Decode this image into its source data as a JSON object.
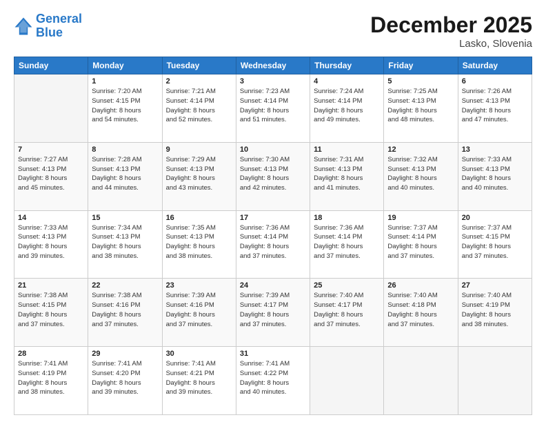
{
  "header": {
    "logo_line1": "General",
    "logo_line2": "Blue",
    "month_year": "December 2025",
    "location": "Lasko, Slovenia"
  },
  "weekdays": [
    "Sunday",
    "Monday",
    "Tuesday",
    "Wednesday",
    "Thursday",
    "Friday",
    "Saturday"
  ],
  "weeks": [
    [
      {
        "day": "",
        "info": ""
      },
      {
        "day": "1",
        "info": "Sunrise: 7:20 AM\nSunset: 4:15 PM\nDaylight: 8 hours\nand 54 minutes."
      },
      {
        "day": "2",
        "info": "Sunrise: 7:21 AM\nSunset: 4:14 PM\nDaylight: 8 hours\nand 52 minutes."
      },
      {
        "day": "3",
        "info": "Sunrise: 7:23 AM\nSunset: 4:14 PM\nDaylight: 8 hours\nand 51 minutes."
      },
      {
        "day": "4",
        "info": "Sunrise: 7:24 AM\nSunset: 4:14 PM\nDaylight: 8 hours\nand 49 minutes."
      },
      {
        "day": "5",
        "info": "Sunrise: 7:25 AM\nSunset: 4:13 PM\nDaylight: 8 hours\nand 48 minutes."
      },
      {
        "day": "6",
        "info": "Sunrise: 7:26 AM\nSunset: 4:13 PM\nDaylight: 8 hours\nand 47 minutes."
      }
    ],
    [
      {
        "day": "7",
        "info": "Sunrise: 7:27 AM\nSunset: 4:13 PM\nDaylight: 8 hours\nand 45 minutes."
      },
      {
        "day": "8",
        "info": "Sunrise: 7:28 AM\nSunset: 4:13 PM\nDaylight: 8 hours\nand 44 minutes."
      },
      {
        "day": "9",
        "info": "Sunrise: 7:29 AM\nSunset: 4:13 PM\nDaylight: 8 hours\nand 43 minutes."
      },
      {
        "day": "10",
        "info": "Sunrise: 7:30 AM\nSunset: 4:13 PM\nDaylight: 8 hours\nand 42 minutes."
      },
      {
        "day": "11",
        "info": "Sunrise: 7:31 AM\nSunset: 4:13 PM\nDaylight: 8 hours\nand 41 minutes."
      },
      {
        "day": "12",
        "info": "Sunrise: 7:32 AM\nSunset: 4:13 PM\nDaylight: 8 hours\nand 40 minutes."
      },
      {
        "day": "13",
        "info": "Sunrise: 7:33 AM\nSunset: 4:13 PM\nDaylight: 8 hours\nand 40 minutes."
      }
    ],
    [
      {
        "day": "14",
        "info": "Sunrise: 7:33 AM\nSunset: 4:13 PM\nDaylight: 8 hours\nand 39 minutes."
      },
      {
        "day": "15",
        "info": "Sunrise: 7:34 AM\nSunset: 4:13 PM\nDaylight: 8 hours\nand 38 minutes."
      },
      {
        "day": "16",
        "info": "Sunrise: 7:35 AM\nSunset: 4:13 PM\nDaylight: 8 hours\nand 38 minutes."
      },
      {
        "day": "17",
        "info": "Sunrise: 7:36 AM\nSunset: 4:14 PM\nDaylight: 8 hours\nand 37 minutes."
      },
      {
        "day": "18",
        "info": "Sunrise: 7:36 AM\nSunset: 4:14 PM\nDaylight: 8 hours\nand 37 minutes."
      },
      {
        "day": "19",
        "info": "Sunrise: 7:37 AM\nSunset: 4:14 PM\nDaylight: 8 hours\nand 37 minutes."
      },
      {
        "day": "20",
        "info": "Sunrise: 7:37 AM\nSunset: 4:15 PM\nDaylight: 8 hours\nand 37 minutes."
      }
    ],
    [
      {
        "day": "21",
        "info": "Sunrise: 7:38 AM\nSunset: 4:15 PM\nDaylight: 8 hours\nand 37 minutes."
      },
      {
        "day": "22",
        "info": "Sunrise: 7:38 AM\nSunset: 4:16 PM\nDaylight: 8 hours\nand 37 minutes."
      },
      {
        "day": "23",
        "info": "Sunrise: 7:39 AM\nSunset: 4:16 PM\nDaylight: 8 hours\nand 37 minutes."
      },
      {
        "day": "24",
        "info": "Sunrise: 7:39 AM\nSunset: 4:17 PM\nDaylight: 8 hours\nand 37 minutes."
      },
      {
        "day": "25",
        "info": "Sunrise: 7:40 AM\nSunset: 4:17 PM\nDaylight: 8 hours\nand 37 minutes."
      },
      {
        "day": "26",
        "info": "Sunrise: 7:40 AM\nSunset: 4:18 PM\nDaylight: 8 hours\nand 37 minutes."
      },
      {
        "day": "27",
        "info": "Sunrise: 7:40 AM\nSunset: 4:19 PM\nDaylight: 8 hours\nand 38 minutes."
      }
    ],
    [
      {
        "day": "28",
        "info": "Sunrise: 7:41 AM\nSunset: 4:19 PM\nDaylight: 8 hours\nand 38 minutes."
      },
      {
        "day": "29",
        "info": "Sunrise: 7:41 AM\nSunset: 4:20 PM\nDaylight: 8 hours\nand 39 minutes."
      },
      {
        "day": "30",
        "info": "Sunrise: 7:41 AM\nSunset: 4:21 PM\nDaylight: 8 hours\nand 39 minutes."
      },
      {
        "day": "31",
        "info": "Sunrise: 7:41 AM\nSunset: 4:22 PM\nDaylight: 8 hours\nand 40 minutes."
      },
      {
        "day": "",
        "info": ""
      },
      {
        "day": "",
        "info": ""
      },
      {
        "day": "",
        "info": ""
      }
    ]
  ]
}
